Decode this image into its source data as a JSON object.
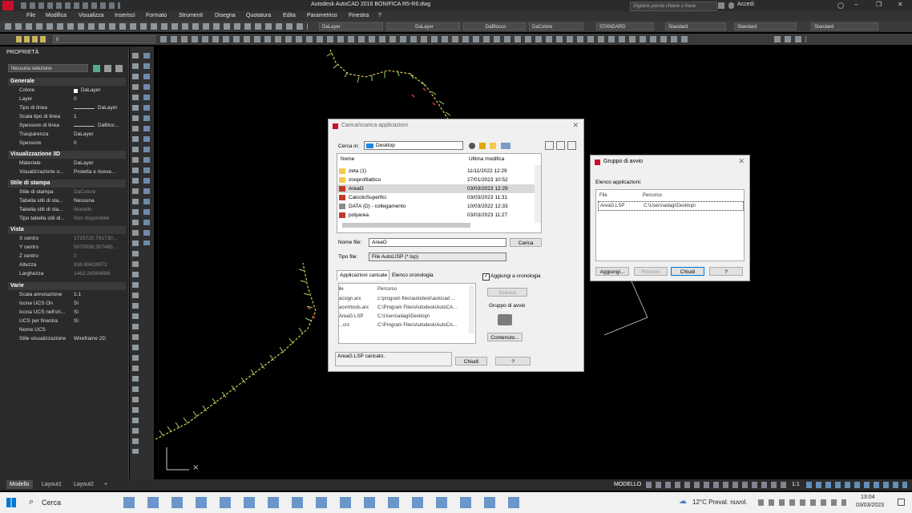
{
  "app": {
    "title": "Autodesk AutoCAD 2016   BONIFICA R5-R6.dwg",
    "search_placeholder": "Digitare parola chiave o frase",
    "login": "Accedi"
  },
  "menu": [
    "File",
    "Modifica",
    "Visualizza",
    "Inserisci",
    "Formato",
    "Strumenti",
    "Disegna",
    "Quotatura",
    "Edita",
    "Parametrico",
    "Finestra",
    "?"
  ],
  "toolbar": {
    "layer_combo": "DaLayer",
    "linetype_combo": "DaLayer",
    "lineweight_combo": "DaBlocco",
    "color_combo": "DaColore",
    "textstyle_combo": "STANDARD",
    "dimstyle_combo": "Standard",
    "tablestyle_combo": "Standard",
    "mleader_combo": "Standard",
    "layer_value": "0"
  },
  "properties": {
    "header": "PROPRIETÀ",
    "selection": "Nessuna selezione",
    "sections": {
      "generale": "Generale",
      "vis3d": "Visualizzazione 3D",
      "stampa": "Stile di stampa",
      "vista": "Vista",
      "varie": "Varie"
    },
    "generale": [
      {
        "k": "Colore",
        "v": "DaLayer"
      },
      {
        "k": "Layer",
        "v": "0"
      },
      {
        "k": "Tipo di linea",
        "v": "DaLayer"
      },
      {
        "k": "Scala tipo di linea",
        "v": "1"
      },
      {
        "k": "Spessore di linea",
        "v": "DaBloc..."
      },
      {
        "k": "Trasparenza",
        "v": "DaLayer"
      },
      {
        "k": "Spessore",
        "v": "0"
      }
    ],
    "vis3d": [
      {
        "k": "Materiale",
        "v": "DaLayer"
      },
      {
        "k": "Visualizzazione o...",
        "v": "Proietta e riceve..."
      }
    ],
    "stampa": [
      {
        "k": "Stile di stampa",
        "v": "DaColore"
      },
      {
        "k": "Tabella stili di sta...",
        "v": "Nessuna"
      },
      {
        "k": "Tabella stili di sta...",
        "v": "Modello"
      },
      {
        "k": "Tipo tabella stili di...",
        "v": "Non disponibile"
      }
    ],
    "vista": [
      {
        "k": "X centro",
        "v": "1715720.791730..."
      },
      {
        "k": "Y centro",
        "v": "5070938.307465..."
      },
      {
        "k": "Z centro",
        "v": "0"
      },
      {
        "k": "Altezza",
        "v": "836.89428972"
      },
      {
        "k": "Larghezza",
        "v": "1462.26584688"
      }
    ],
    "varie": [
      {
        "k": "Scala annotazione",
        "v": "1:1"
      },
      {
        "k": "Icona UCS On",
        "v": "Sì"
      },
      {
        "k": "Icona UCS nell'ori...",
        "v": "Sì"
      },
      {
        "k": "UCS per finestra",
        "v": "Sì"
      },
      {
        "k": "Nome UCS",
        "v": ""
      },
      {
        "k": "Stile visualizzazione",
        "v": "Wireframe 2D"
      }
    ]
  },
  "load_dialog": {
    "title": "Carica/scarica applicazioni",
    "search_in_label": "Cerca in:",
    "search_in_value": "Desktop",
    "col_name": "Nome",
    "col_date": "Ultima modifica",
    "files": [
      {
        "name": "zeta (1)",
        "date": "11/11/2022 12:29",
        "type": "folder"
      },
      {
        "name": "zooprofilattico",
        "date": "27/01/2023 10:52",
        "type": "folder"
      },
      {
        "name": "AreaG",
        "date": "03/03/2023 12:29",
        "type": "lsp"
      },
      {
        "name": "CalcoloSuperfici",
        "date": "03/03/2023 11:31",
        "type": "lsp"
      },
      {
        "name": "DATA (D) - collegamento",
        "date": "10/03/2022 12:33",
        "type": "link"
      },
      {
        "name": "polyarea",
        "date": "03/03/2023 11:27",
        "type": "lsp"
      }
    ],
    "filename_label": "Nome file:",
    "filename_value": "AreaG",
    "filetype_label": "Tipo file:",
    "filetype_value": "File AutoLISP (*.lsp)",
    "load_button": "Carica",
    "tab_loaded": "Applicazioni caricate",
    "tab_history": "Elenco cronologia",
    "add_history_label": "Aggiungi a cronologia",
    "loaded_col_file": "File",
    "loaded_col_path": "Percorso",
    "loaded": [
      {
        "file": "acsign.arx",
        "path": "c:\\program files\\autodesk\\autocad ..."
      },
      {
        "file": "acvmtools.arx",
        "path": "C:\\Program Files\\Autodesk\\AutoCA..."
      },
      {
        "file": "AreaG.LSP",
        "path": "C:\\Users\\adagi\\Desktop\\"
      },
      {
        "file": "...crx",
        "path": "C:\\Program Files\\Autodesk\\AutoCA..."
      }
    ],
    "unload_button": "Scarica",
    "startup_group_label": "Gruppo di avvio",
    "contents_button": "Contenuto...",
    "status_text": "AreaG.LSP caricato.",
    "close_button": "Chiudi",
    "help_button": "?"
  },
  "startup_dialog": {
    "title": "Gruppo di avvio",
    "list_label": "Elenco applicazioni:",
    "col_file": "File",
    "col_path": "Percorso",
    "rows": [
      {
        "file": "AreaG.LSP",
        "path": "C:\\Users\\adagi\\Desktop\\"
      }
    ],
    "add_button": "Aggiungi...",
    "remove_button": "Rimuovi",
    "close_button": "Chiudi",
    "help_button": "?"
  },
  "layout_tabs": [
    "Modello",
    "Layout1",
    "Layout2"
  ],
  "status_bar": {
    "mode": "MODELLO",
    "scale": "1:1"
  },
  "taskbar": {
    "search_label": "Cerca",
    "weather": "12°C  Preval. nuvol.",
    "time": "13:04",
    "date": "03/03/2023"
  }
}
